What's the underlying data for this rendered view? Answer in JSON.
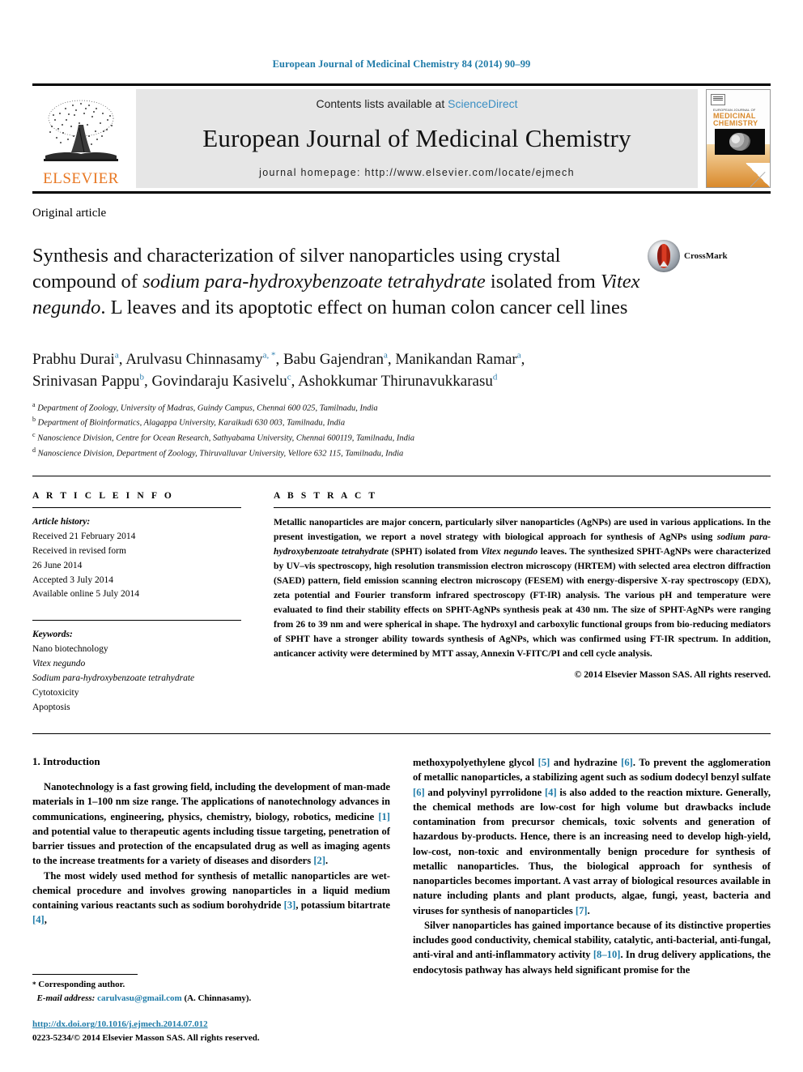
{
  "running_head": "European Journal of Medicinal Chemistry 84 (2014) 90–99",
  "masthead": {
    "contents_prefix": "Contents lists available at ",
    "sciencedirect": "ScienceDirect",
    "journal_title": "European Journal of Medicinal Chemistry",
    "homepage": "journal homepage: http://www.elsevier.com/locate/ejmech",
    "publisher_logo_text": "ELSEVIER",
    "cover": {
      "line1": "EUROPEAN JOURNAL OF",
      "line2": "MEDICINAL",
      "line3": "CHEMISTRY"
    },
    "accent_color": "#3a8fc4",
    "elsevier_orange": "#E87722"
  },
  "article": {
    "type": "Original article",
    "title_part1": "Synthesis and characterization of silver nanoparticles using crystal compound of ",
    "title_italic1": "sodium para-hydroxybenzoate tetrahydrate",
    "title_part2": " isolated from ",
    "title_italic2": "Vitex negundo",
    "title_part3": ". L leaves and its apoptotic effect on human colon cancer cell lines",
    "crossmark_label": "CrossMark"
  },
  "authors": {
    "list": [
      {
        "name": "Prabhu Durai",
        "marks": "a"
      },
      {
        "name": "Arulvasu Chinnasamy",
        "marks": "a, *"
      },
      {
        "name": "Babu Gajendran",
        "marks": "a"
      },
      {
        "name": "Manikandan Ramar",
        "marks": "a"
      },
      {
        "name": "Srinivasan Pappu",
        "marks": "b"
      },
      {
        "name": "Govindaraju Kasivelu",
        "marks": "c"
      },
      {
        "name": "Ashokkumar Thirunavukkarasu",
        "marks": "d"
      }
    ],
    "affiliations": [
      {
        "mark": "a",
        "text": "Department of Zoology, University of Madras, Guindy Campus, Chennai 600 025, Tamilnadu, India"
      },
      {
        "mark": "b",
        "text": "Department of Bioinformatics, Alagappa University, Karaikudi 630 003, Tamilnadu, India"
      },
      {
        "mark": "c",
        "text": "Nanoscience Division, Centre for Ocean Research, Sathyabama University, Chennai 600119, Tamilnadu, India"
      },
      {
        "mark": "d",
        "text": "Nanoscience Division, Department of Zoology, Thiruvalluvar University, Vellore 632 115, Tamilnadu, India"
      }
    ]
  },
  "article_info": {
    "heading": "A R T I C L E  I N F O",
    "history_label": "Article history:",
    "history": [
      "Received 21 February 2014",
      "Received in revised form",
      "26 June 2014",
      "Accepted 3 July 2014",
      "Available online 5 July 2014"
    ],
    "keywords_label": "Keywords:",
    "keywords": [
      {
        "text": "Nano biotechnology",
        "italic": false
      },
      {
        "text": "Vitex negundo",
        "italic": true
      },
      {
        "text": "Sodium para-hydroxybenzoate tetrahydrate",
        "italic": true
      },
      {
        "text": "Cytotoxicity",
        "italic": false
      },
      {
        "text": "Apoptosis",
        "italic": false
      }
    ]
  },
  "abstract": {
    "heading": "A B S T R A C T",
    "p1": "Metallic nanoparticles are major concern, particularly silver nanoparticles (AgNPs) are used in various applications. In the present investigation, we report a novel strategy with biological approach for synthesis of AgNPs using ",
    "it1": "sodium para-hydroxybenzoate tetrahydrate",
    "p2": " (SPHT) isolated from ",
    "it2": "Vitex negundo",
    "p3": " leaves. The synthesized SPHT-AgNPs were characterized by UV–vis spectroscopy, high resolution transmission electron microscopy (HRTEM) with selected area electron diffraction (SAED) pattern, field emission scanning electron microscopy (FESEM) with energy-dispersive X-ray spectroscopy (EDX), zeta potential and Fourier transform infrared spectroscopy (FT-IR) analysis. The various pH and temperature were evaluated to find their stability effects on SPHT-AgNPs synthesis peak at 430 nm. The size of SPHT-AgNPs were ranging from 26 to 39 nm and were spherical in shape. The hydroxyl and carboxylic functional groups from bio-reducing mediators of SPHT have a stronger ability towards synthesis of AgNPs, which was confirmed using FT-IR spectrum. In addition, anticancer activity were determined by MTT assay, Annexin V-FITC/PI and cell cycle analysis.",
    "copyright": "© 2014 Elsevier Masson SAS. All rights reserved."
  },
  "introduction": {
    "heading": "1. Introduction",
    "left": [
      {
        "segments": [
          {
            "t": "Nanotechnology is a fast growing field, including the development of man-made materials in 1–100 nm size range. The applications of nanotechnology advances in communications, engineering, physics, chemistry, biology, robotics, medicine ",
            "k": "text"
          },
          {
            "t": "[1]",
            "k": "ref"
          },
          {
            "t": " and potential value to therapeutic agents including tissue targeting, penetration of barrier tissues and protection of the encapsulated drug as well as imaging agents to the increase treatments for a variety of diseases and disorders ",
            "k": "text"
          },
          {
            "t": "[2]",
            "k": "ref"
          },
          {
            "t": ".",
            "k": "text"
          }
        ]
      },
      {
        "segments": [
          {
            "t": "The most widely used method for synthesis of metallic nanoparticles are wet-chemical procedure and involves growing nanoparticles in a liquid medium containing various reactants such as sodium borohydride ",
            "k": "text"
          },
          {
            "t": "[3]",
            "k": "ref"
          },
          {
            "t": ", potassium bitartrate ",
            "k": "text"
          },
          {
            "t": "[4]",
            "k": "ref"
          },
          {
            "t": ",",
            "k": "text"
          }
        ]
      }
    ],
    "right": [
      {
        "segments": [
          {
            "t": "methoxypolyethylene glycol ",
            "k": "text"
          },
          {
            "t": "[5]",
            "k": "ref"
          },
          {
            "t": " and hydrazine ",
            "k": "text"
          },
          {
            "t": "[6]",
            "k": "ref"
          },
          {
            "t": ". To prevent the agglomeration of metallic nanoparticles, a stabilizing agent such as sodium dodecyl benzyl sulfate ",
            "k": "text"
          },
          {
            "t": "[6]",
            "k": "ref"
          },
          {
            "t": " and polyvinyl pyrrolidone ",
            "k": "text"
          },
          {
            "t": "[4]",
            "k": "ref"
          },
          {
            "t": " is also added to the reaction mixture. Generally, the chemical methods are low-cost for high volume but drawbacks include contamination from precursor chemicals, toxic solvents and generation of hazardous by-products. Hence, there is an increasing need to develop high-yield, low-cost, non-toxic and environmentally benign procedure for synthesis of metallic nanoparticles. Thus, the biological approach for synthesis of nanoparticles becomes important. A vast array of biological resources available in nature including plants and plant products, algae, fungi, yeast, bacteria and viruses for synthesis of nanoparticles ",
            "k": "text"
          },
          {
            "t": "[7]",
            "k": "ref"
          },
          {
            "t": ".",
            "k": "text"
          }
        ]
      },
      {
        "segments": [
          {
            "t": "Silver nanoparticles has gained importance because of its distinctive properties includes good conductivity, chemical stability, catalytic, anti-bacterial, anti-fungal, anti-viral and anti-inflammatory activity ",
            "k": "text"
          },
          {
            "t": "[8–10]",
            "k": "ref"
          },
          {
            "t": ". In drug delivery applications, the endocytosis pathway has always held significant promise for the",
            "k": "text"
          }
        ]
      }
    ]
  },
  "footnote": {
    "corresponding_star": "*",
    "corresponding": "Corresponding author.",
    "email_label": "E-mail address:",
    "email": "carulvasu@gmail.com",
    "email_owner": "(A. Chinnasamy).",
    "doi": "http://dx.doi.org/10.1016/j.ejmech.2014.07.012",
    "issn_line": "0223-5234/© 2014 Elsevier Masson SAS. All rights reserved."
  }
}
